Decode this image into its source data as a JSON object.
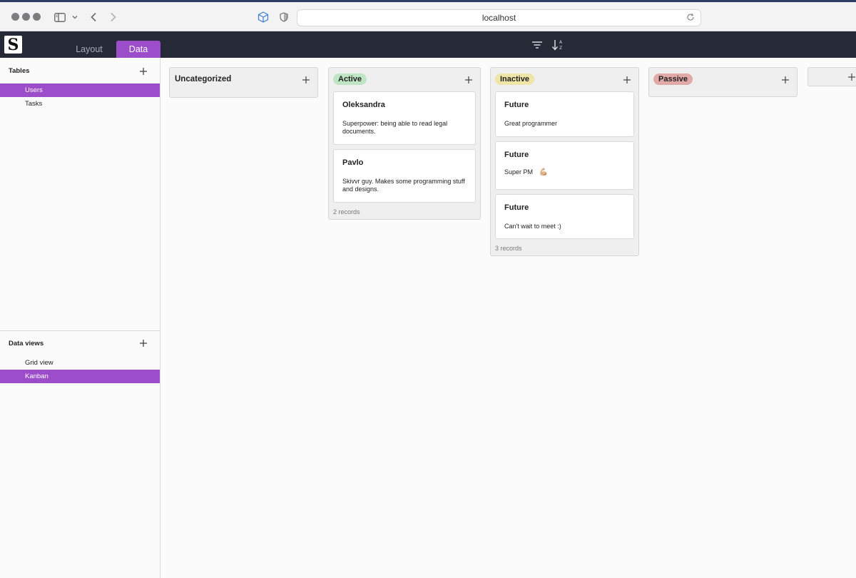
{
  "browser": {
    "url": "localhost"
  },
  "app": {
    "logo_letter": "S",
    "tabs": [
      {
        "label": "Layout",
        "active": false
      },
      {
        "label": "Data",
        "active": true
      }
    ],
    "accent_color": "#9b4dca",
    "header_color": "#252a36"
  },
  "sidebar": {
    "tables_title": "Tables",
    "tables": [
      {
        "label": "Users",
        "active": true
      },
      {
        "label": "Tasks",
        "active": false
      }
    ],
    "views_title": "Data views",
    "views": [
      {
        "label": "Grid view",
        "active": false
      },
      {
        "label": "Kanban",
        "active": true
      }
    ]
  },
  "board": {
    "columns": [
      {
        "title": "Uncategorized",
        "cards": []
      },
      {
        "title": "Active",
        "badge_color": "#bfe4c6",
        "cards": [
          {
            "title": "Oleksandra",
            "body": "Superpower: being able to read legal documents."
          },
          {
            "title": "Pavlo",
            "body": "Skivvr guy. Makes some programming stuff and designs."
          }
        ],
        "records": "2 records"
      },
      {
        "title": "Inactive",
        "badge_color": "#eee5a6",
        "cards": [
          {
            "title": "Future",
            "body": "Great programmer"
          },
          {
            "title": "Future",
            "body": "Super PM",
            "emoji": "💪🏼"
          },
          {
            "title": "Future",
            "body": "Can't wait to meet :)"
          }
        ],
        "records": "3 records"
      },
      {
        "title": "Passive",
        "badge_color": "#e2a9a9",
        "cards": []
      }
    ]
  }
}
